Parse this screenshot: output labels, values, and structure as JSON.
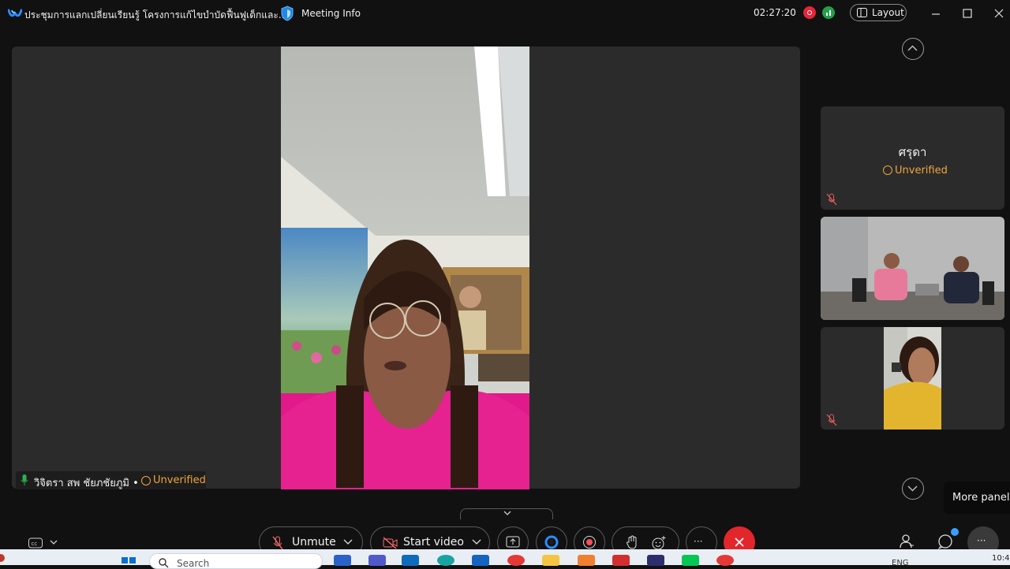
{
  "titlebar": {
    "meeting_title": "ประชุมการแลกเปลี่ยนเรียนรู้ โครงการแก้ไขบำบัดฟื้นฟูเด็กและ...",
    "meeting_info_label": "Meeting Info",
    "elapsed_time": "02:27:20",
    "layout_label": "Layout"
  },
  "stage": {
    "active_speaker": "วิจิตรา สพ ชัยภชัยภูมิ",
    "separator": "•",
    "verification": "Unverified"
  },
  "participants_panel": {
    "tiles": [
      {
        "name": "ศรุดา",
        "verification": "Unverified",
        "muted": true,
        "video": false
      },
      {
        "video": true
      },
      {
        "muted": true,
        "video": true
      }
    ]
  },
  "tooltip": {
    "text": "More panels"
  },
  "controls": {
    "unmute_label": "Unmute",
    "start_video_label": "Start video",
    "more_symbol": "···",
    "panel_more_symbol": "···"
  },
  "taskbar": {
    "search_placeholder": "Search",
    "language": "ENG",
    "clock": "10:4"
  },
  "colors": {
    "accent_warning": "#f0a53a",
    "leave_red": "#e3262c",
    "recording_red": "#e8243a",
    "network_green": "#23a04a"
  }
}
